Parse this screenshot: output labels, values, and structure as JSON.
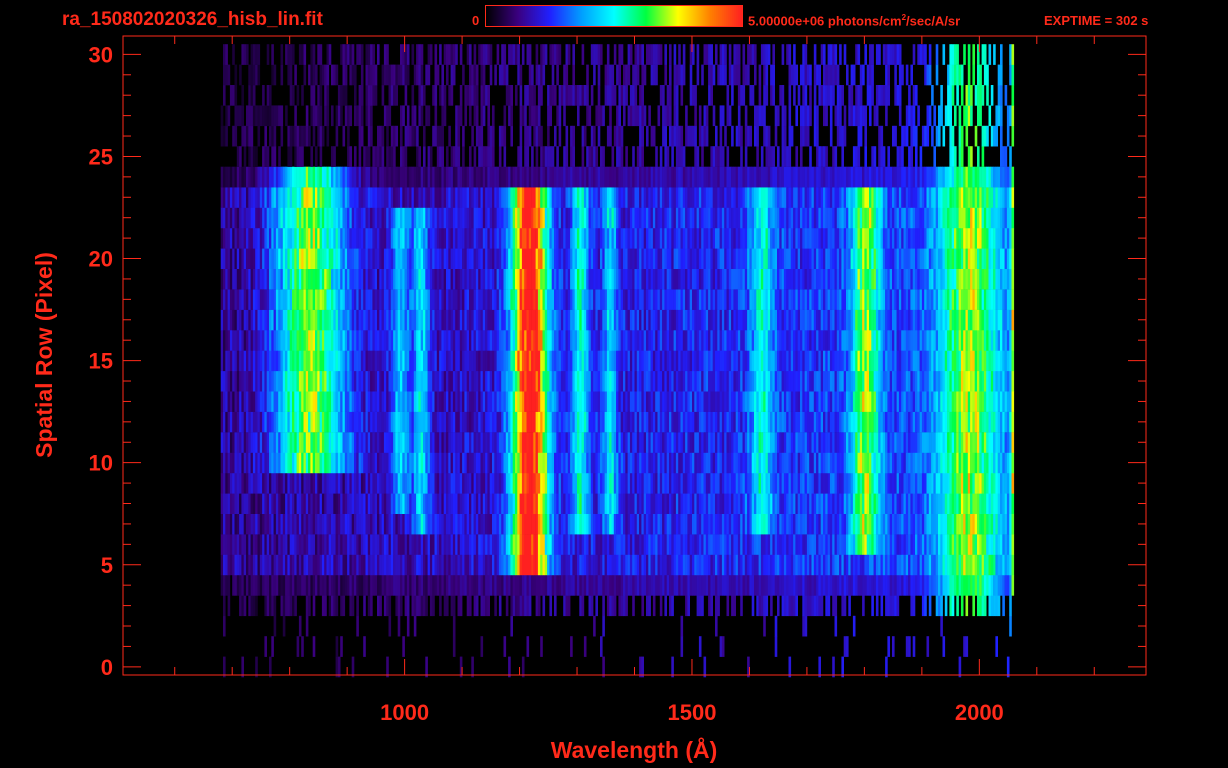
{
  "header": {
    "file_title": "ra_150802020326_hisb_lin.fit",
    "colorbar_min": "0",
    "colorbar_max_value": "5.00000e+06",
    "colorbar_unit_pre": " photons/cm",
    "colorbar_unit_sup": "2",
    "colorbar_unit_post": "/sec/A/sr",
    "exptime": "EXPTIME = 302 s"
  },
  "colors": {
    "axis": "#ff2a1a",
    "background": "#000000",
    "colormap": [
      "#000000",
      "#3a0080",
      "#2020ff",
      "#00a0ff",
      "#00ffff",
      "#00ff40",
      "#ffff00",
      "#ff8000",
      "#ff2020"
    ]
  },
  "chart_data": {
    "type": "heatmap",
    "title": "ra_150802020326_hisb_lin.fit",
    "xlabel": "Wavelength (Å)",
    "ylabel": "Spatial Row (Pixel)",
    "xlim": [
      510,
      2290
    ],
    "ylim": [
      -0.4,
      30.9
    ],
    "xticks": [
      1000,
      1500,
      2000
    ],
    "xticklabels": [
      "1000",
      "1500",
      "2000"
    ],
    "yticks": [
      0,
      5,
      10,
      15,
      20,
      25,
      30
    ],
    "yticklabels": [
      "0",
      "5",
      "10",
      "15",
      "20",
      "25",
      "30"
    ],
    "color_range": [
      0,
      5000000
    ],
    "value_unit": "photons/cm^2/sec/A/sr",
    "rows": {
      "min": 0,
      "max": 30
    },
    "data_extent_x": [
      680,
      2060
    ],
    "emission_features": [
      {
        "x": 1216,
        "peak": 4800000,
        "width": 30,
        "row_range": [
          5,
          23
        ]
      },
      {
        "x": 1304,
        "peak": 1700000,
        "width": 14,
        "row_range": [
          7,
          23
        ]
      },
      {
        "x": 1356,
        "peak": 1300000,
        "width": 12,
        "row_range": [
          7,
          23
        ]
      },
      {
        "x": 1026,
        "peak": 1500000,
        "width": 14,
        "row_range": [
          7,
          22
        ]
      },
      {
        "x": 990,
        "peak": 1300000,
        "width": 16,
        "row_range": [
          8,
          22
        ]
      },
      {
        "x": 834,
        "peak": 2800000,
        "width": 60,
        "row_range": [
          10,
          24
        ]
      },
      {
        "x": 1620,
        "peak": 1400000,
        "width": 20,
        "row_range": [
          7,
          23
        ]
      },
      {
        "x": 1800,
        "peak": 2300000,
        "width": 24,
        "row_range": [
          6,
          23
        ]
      },
      {
        "x": 1980,
        "peak": 2200000,
        "width": 50,
        "row_range": [
          3,
          30
        ]
      },
      {
        "x": 2060,
        "peak": 3200000,
        "width": 6,
        "row_range": [
          1,
          30
        ]
      }
    ],
    "background_level": 900000
  }
}
